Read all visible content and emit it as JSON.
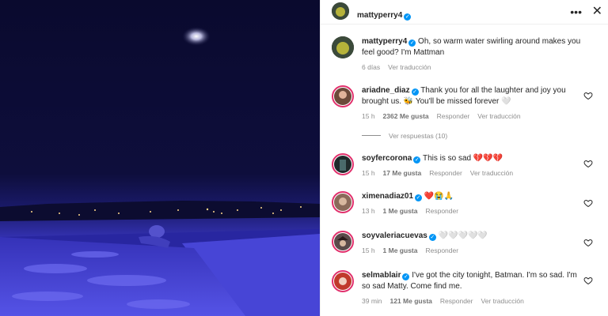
{
  "post": {
    "author": "mattyperry4",
    "caption": "Oh, so warm water swirling around makes you feel good? I'm Mattman",
    "age": "6 días",
    "see_translation": "Ver traducción"
  },
  "colors": {
    "verified": "#0095f6",
    "story_ring": "#e1306c",
    "muted": "#8e8e8e",
    "pool_light": "#4a48d8"
  },
  "icons": {
    "more": "more-dots-icon",
    "close": "close-icon",
    "like": "heart-icon",
    "verified": "verified-badge-icon"
  },
  "comments": [
    {
      "user": "ariadne_diaz",
      "text": "Thank you for all the laughter and joy you brought us. 🐝 You'll be missed forever 🤍",
      "time": "15 h",
      "likes": "2362 Me gusta",
      "reply": "Responder",
      "translate": "Ver traducción"
    },
    {
      "user": "soyfercorona",
      "text": "This is so sad 💔💔💔",
      "time": "15 h",
      "likes": "17 Me gusta",
      "reply": "Responder",
      "translate": "Ver traducción"
    },
    {
      "user": "ximenadiaz01",
      "text": "❤️😭🙏",
      "time": "13 h",
      "likes": "1 Me gusta",
      "reply": "Responder",
      "translate": ""
    },
    {
      "user": "soyvaleriacuevas",
      "text": "🤍🤍🤍🤍🤍",
      "time": "15 h",
      "likes": "1 Me gusta",
      "reply": "Responder",
      "translate": ""
    },
    {
      "user": "selmablair",
      "text": "I've got the city tonight, Batman. I'm so sad. I'm so sad Matty. Come find me.",
      "time": "39 min",
      "likes": "121 Me gusta",
      "reply": "Responder",
      "translate": "Ver traducción"
    }
  ],
  "replies_link": "Ver respuestas (10)"
}
